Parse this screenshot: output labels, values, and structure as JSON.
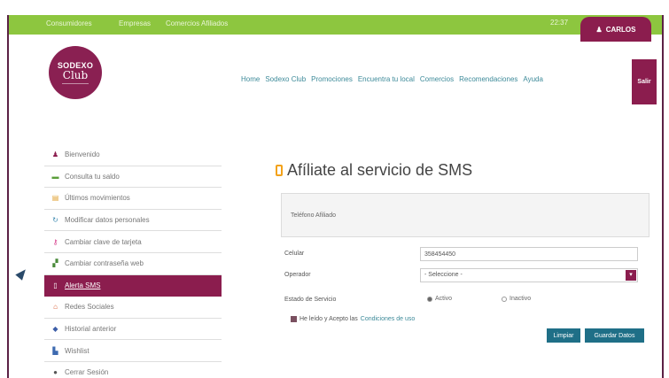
{
  "topbar": {
    "links": [
      "Consumidores",
      "Empresas",
      "Comercios Afiliados"
    ],
    "counter": "22:37",
    "user_name": "CARLOS"
  },
  "logo": {
    "line1": "SODEXO",
    "line2": "Club"
  },
  "nav": {
    "items": [
      "Home",
      "Sodexo Club",
      "Promociones",
      "Encuentra tu local",
      "Comercios",
      "Recomendaciones",
      "Ayuda"
    ],
    "logout": "Salir"
  },
  "sidebar": {
    "items": [
      {
        "label": "Bienvenido",
        "icon": "user-icon",
        "glyph": "♟",
        "color": "#8b1d4e",
        "active": false
      },
      {
        "label": "Consulta tu saldo",
        "icon": "money-icon",
        "glyph": "▬",
        "color": "#5a9e3a",
        "active": false
      },
      {
        "label": "Últimos movimientos",
        "icon": "list-icon",
        "glyph": "▤",
        "color": "#e0a030",
        "active": false
      },
      {
        "label": "Modificar datos personales",
        "icon": "refresh-icon",
        "glyph": "↻",
        "color": "#3d8ab0",
        "active": false
      },
      {
        "label": "Cambiar clave de tarjeta",
        "icon": "key-icon",
        "glyph": "⚷",
        "color": "#d63a8a",
        "active": false
      },
      {
        "label": "Cambiar contraseña web",
        "icon": "lock-icon",
        "glyph": "▞",
        "color": "#4a8a3a",
        "active": false
      },
      {
        "label": "Alerta SMS",
        "icon": "phone-icon",
        "glyph": "▯",
        "color": "#ffffff",
        "active": true
      },
      {
        "label": "Redes Sociales",
        "icon": "home-icon",
        "glyph": "⌂",
        "color": "#d6552a",
        "active": false
      },
      {
        "label": "Historial anterior",
        "icon": "tag-icon",
        "glyph": "◆",
        "color": "#3d5ea8",
        "active": false
      },
      {
        "label": "Wishlist",
        "icon": "bookmark-icon",
        "glyph": "▙",
        "color": "#3d6ab0",
        "active": false
      },
      {
        "label": "Cerrar Sesión",
        "icon": "power-icon",
        "glyph": "●",
        "color": "#555555",
        "active": false
      }
    ]
  },
  "main": {
    "title": "Afíliate al servicio de SMS",
    "panel_label": "Teléfono Afiliado",
    "form": {
      "celular_label": "Celular",
      "celular_value": "358454450",
      "operador_label": "Operador",
      "operador_value": "- Seleccione -",
      "estado_label": "Estado de Servicio",
      "estado_options": [
        "Activo",
        "Inactivo"
      ],
      "estado_selected": "Activo",
      "terms_prefix": "He leído y Acepto las",
      "terms_link": "Condiciones de uso",
      "clear_button": "Limpiar",
      "save_button": "Guardar Datos"
    }
  },
  "colors": {
    "topbar": "#8dc63f",
    "brand": "#8b1d4e",
    "button": "#1f6f87",
    "link": "#3d8a99"
  }
}
